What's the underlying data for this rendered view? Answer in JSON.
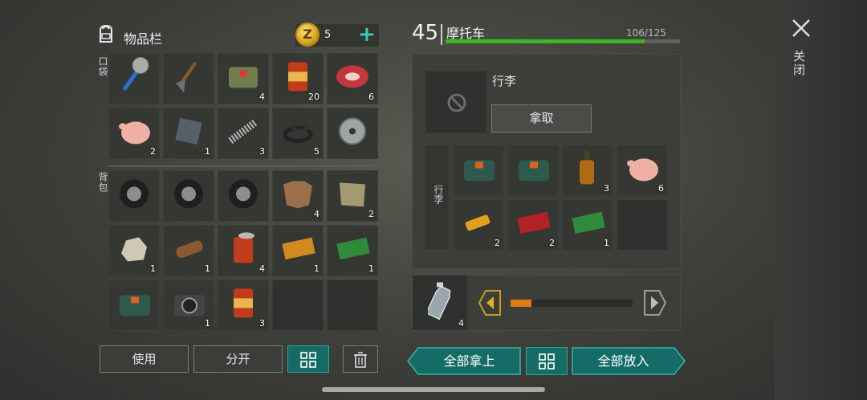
{
  "inventory": {
    "title": "物品栏",
    "coins": "5",
    "coin_symbol": "Z",
    "pocket_label": "口袋",
    "backpack_label": "背包",
    "pockets": [
      {
        "name": "saw-club",
        "qty": ""
      },
      {
        "name": "shovel",
        "qty": ""
      },
      {
        "name": "medkit",
        "qty": "4"
      },
      {
        "name": "canned-food",
        "qty": "20"
      },
      {
        "name": "raw-meat",
        "qty": "6"
      },
      {
        "name": "raw-chicken",
        "qty": "2"
      },
      {
        "name": "metal-plate",
        "qty": "1"
      },
      {
        "name": "spring",
        "qty": "3"
      },
      {
        "name": "rubber-rings",
        "qty": "5"
      },
      {
        "name": "saw-blade",
        "qty": ""
      }
    ],
    "backpack": [
      {
        "name": "tire",
        "qty": ""
      },
      {
        "name": "tire",
        "qty": ""
      },
      {
        "name": "tire",
        "qty": ""
      },
      {
        "name": "animal-hide",
        "qty": "4"
      },
      {
        "name": "cloth",
        "qty": "2"
      },
      {
        "name": "stone",
        "qty": "1"
      },
      {
        "name": "log",
        "qty": "1"
      },
      {
        "name": "open-can",
        "qty": "4"
      },
      {
        "name": "orange-coupon",
        "qty": "1"
      },
      {
        "name": "ration-coupon",
        "qty": "1"
      },
      {
        "name": "bomb-bag",
        "qty": ""
      },
      {
        "name": "camera",
        "qty": "1"
      },
      {
        "name": "canned-food",
        "qty": "3"
      },
      {
        "name": "empty",
        "qty": ""
      },
      {
        "name": "empty",
        "qty": ""
      }
    ]
  },
  "buttons": {
    "use": "使用",
    "split": "分开",
    "take_all": "全部拿上",
    "put_all": "全部放入"
  },
  "vehicle": {
    "level": "45",
    "name": "摩托车",
    "durability": "106/125",
    "durability_fraction": 0.848,
    "luggage_label": "行李",
    "take_label": "拿取",
    "luggage_side_label": "行李",
    "items": [
      {
        "name": "bomb-bag",
        "qty": ""
      },
      {
        "name": "bomb-bag",
        "qty": ""
      },
      {
        "name": "whiskey-bottle",
        "qty": "3"
      },
      {
        "name": "raw-chicken",
        "qty": "6"
      },
      {
        "name": "usb-drive",
        "qty": "2"
      },
      {
        "name": "combat-coupon",
        "qty": "2"
      },
      {
        "name": "ration-coupon",
        "qty": "1"
      },
      {
        "name": "empty",
        "qty": ""
      }
    ],
    "fuel": {
      "item": "water-bottle",
      "qty": "4",
      "level_fraction": 0.17
    }
  },
  "close_label": "关闭",
  "colors": {
    "accent_teal": "#156c66",
    "fuel_orange": "#e07a14",
    "durability_green": "#3cb526"
  }
}
